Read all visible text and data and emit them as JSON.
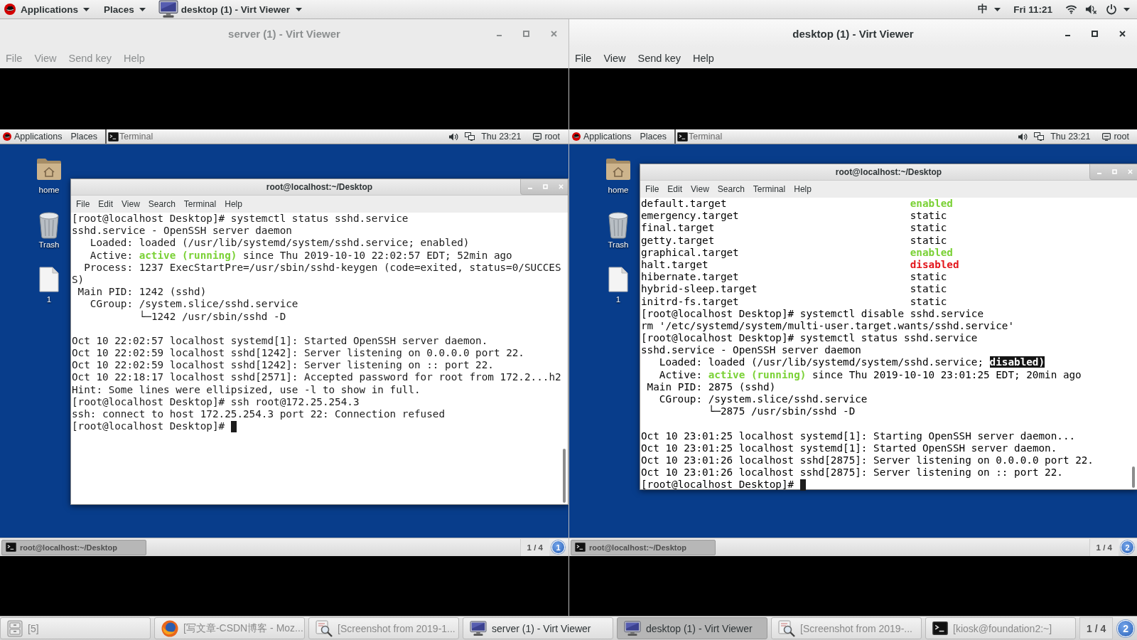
{
  "top_bar": {
    "menus": [
      "Applications",
      "Places"
    ],
    "app_menu": "desktop (1) - Virt Viewer",
    "input_method": "中",
    "clock": "Fri 11:21"
  },
  "windows": [
    {
      "title": "server (1) - Virt Viewer",
      "focused": false,
      "menu": [
        "File",
        "View",
        "Send key",
        "Help"
      ],
      "guest": {
        "panel": {
          "menus": [
            "Applications",
            "Places"
          ],
          "task": "Terminal",
          "clock": "Thu 23:21",
          "user": "root"
        },
        "desktop_icons": [
          {
            "kind": "home",
            "label": "home"
          },
          {
            "kind": "trash",
            "label": "Trash"
          },
          {
            "kind": "file",
            "label": "1"
          }
        ],
        "terminal": {
          "title": "root@localhost:~/Desktop",
          "menu": [
            "File",
            "Edit",
            "View",
            "Search",
            "Terminal",
            "Help"
          ],
          "lines": [
            {
              "kind": "text",
              "text": "[root@localhost Desktop]# systemctl status sshd.service"
            },
            {
              "kind": "text",
              "text": "sshd.service - OpenSSH server daemon"
            },
            {
              "kind": "field",
              "label": "Loaded:",
              "value": [
                {
                  "kind": "plain",
                  "text": "loaded (/usr/lib/systemd/system/sshd.service; enabled)"
                }
              ]
            },
            {
              "kind": "field",
              "label": "Active:",
              "value": [
                {
                  "kind": "ok",
                  "text": "active (running)"
                },
                {
                  "kind": "plain",
                  "text": " since Thu 2019-10-10 22:02:57 EDT; 52min ago"
                }
              ]
            },
            {
              "kind": "field",
              "label": "Process:",
              "value": [
                {
                  "kind": "plain",
                  "text": "1237 ExecStartPre=/usr/sbin/sshd-keygen (code=exited, status=0/SUCCES"
                }
              ]
            },
            {
              "kind": "text",
              "text": "S)"
            },
            {
              "kind": "field",
              "label": "Main PID:",
              "value": [
                {
                  "kind": "plain",
                  "text": "1242 (sshd)"
                }
              ]
            },
            {
              "kind": "field",
              "label": "CGroup:",
              "value": [
                {
                  "kind": "plain",
                  "text": "/system.slice/sshd.service"
                }
              ]
            },
            {
              "kind": "tree",
              "text": "└─1242 /usr/sbin/sshd -D"
            },
            {
              "kind": "blank"
            },
            {
              "kind": "text",
              "text": "Oct 10 22:02:57 localhost systemd[1]: Started OpenSSH server daemon."
            },
            {
              "kind": "text",
              "text": "Oct 10 22:02:59 localhost sshd[1242]: Server listening on 0.0.0.0 port 22."
            },
            {
              "kind": "text",
              "text": "Oct 10 22:02:59 localhost sshd[1242]: Server listening on :: port 22."
            },
            {
              "kind": "text",
              "text": "Oct 10 22:18:17 localhost sshd[2571]: Accepted password for root from 172.2...h2"
            },
            {
              "kind": "text",
              "text": "Hint: Some lines were ellipsized, use -l to show in full."
            },
            {
              "kind": "text",
              "text": "[root@localhost Desktop]# ssh root@172.25.254.3"
            },
            {
              "kind": "text",
              "text": "ssh: connect to host 172.25.254.3 port 22: Connection refused"
            },
            {
              "kind": "prompt",
              "text": "[root@localhost Desktop]#",
              "cursor": true
            }
          ]
        },
        "window_list": [
          {
            "label": "root@localhost:~/Desktop",
            "selected": true
          }
        ],
        "workspace": "1 / 4",
        "notifications": "1"
      }
    },
    {
      "title": "desktop (1) - Virt Viewer",
      "focused": true,
      "menu": [
        "File",
        "View",
        "Send key",
        "Help"
      ],
      "guest": {
        "panel": {
          "menus": [
            "Applications",
            "Places"
          ],
          "task": "Terminal",
          "clock": "Thu 23:21",
          "user": "root"
        },
        "desktop_icons": [
          {
            "kind": "home",
            "label": "home"
          },
          {
            "kind": "trash",
            "label": "Trash"
          },
          {
            "kind": "file",
            "label": "1"
          }
        ],
        "terminal": {
          "title": "root@localhost:~/Desktop",
          "menu": [
            "File",
            "Edit",
            "View",
            "Search",
            "Terminal",
            "Help"
          ],
          "lines": [
            {
              "kind": "unit",
              "unit": "default.target",
              "state": {
                "kind": "ok",
                "text": "enabled"
              }
            },
            {
              "kind": "unit",
              "unit": "emergency.target",
              "state": {
                "kind": "plain",
                "text": "static"
              }
            },
            {
              "kind": "unit",
              "unit": "final.target",
              "state": {
                "kind": "plain",
                "text": "static"
              }
            },
            {
              "kind": "unit",
              "unit": "getty.target",
              "state": {
                "kind": "plain",
                "text": "static"
              }
            },
            {
              "kind": "unit",
              "unit": "graphical.target",
              "state": {
                "kind": "ok",
                "text": "enabled"
              }
            },
            {
              "kind": "unit",
              "unit": "halt.target",
              "state": {
                "kind": "error",
                "text": "disabled"
              }
            },
            {
              "kind": "unit",
              "unit": "hibernate.target",
              "state": {
                "kind": "plain",
                "text": "static"
              }
            },
            {
              "kind": "unit",
              "unit": "hybrid-sleep.target",
              "state": {
                "kind": "plain",
                "text": "static"
              }
            },
            {
              "kind": "unit",
              "unit": "initrd-fs.target",
              "state": {
                "kind": "plain",
                "text": "static"
              }
            },
            {
              "kind": "text",
              "text": "[root@localhost Desktop]# systemctl disable sshd.service"
            },
            {
              "kind": "text",
              "text": "rm '/etc/systemd/system/multi-user.target.wants/sshd.service'"
            },
            {
              "kind": "text",
              "text": "[root@localhost Desktop]# systemctl status sshd.service"
            },
            {
              "kind": "text",
              "text": "sshd.service - OpenSSH server daemon"
            },
            {
              "kind": "field",
              "label": "Loaded:",
              "value": [
                {
                  "kind": "plain",
                  "text": "loaded (/usr/lib/systemd/system/sshd.service; "
                },
                {
                  "kind": "highlight",
                  "text": "disabled)"
                }
              ]
            },
            {
              "kind": "field",
              "label": "Active:",
              "value": [
                {
                  "kind": "ok",
                  "text": "active (running)"
                },
                {
                  "kind": "plain",
                  "text": " since Thu 2019-10-10 23:01:25 EDT; 20min ago"
                }
              ]
            },
            {
              "kind": "field",
              "label": "Main PID:",
              "value": [
                {
                  "kind": "plain",
                  "text": "2875 (sshd)"
                }
              ]
            },
            {
              "kind": "field",
              "label": "CGroup:",
              "value": [
                {
                  "kind": "plain",
                  "text": "/system.slice/sshd.service"
                }
              ]
            },
            {
              "kind": "tree",
              "text": "└─2875 /usr/sbin/sshd -D"
            },
            {
              "kind": "blank"
            },
            {
              "kind": "text",
              "text": "Oct 10 23:01:25 localhost systemd[1]: Starting OpenSSH server daemon..."
            },
            {
              "kind": "text",
              "text": "Oct 10 23:01:25 localhost systemd[1]: Started OpenSSH server daemon."
            },
            {
              "kind": "text",
              "text": "Oct 10 23:01:26 localhost sshd[2875]: Server listening on 0.0.0.0 port 22."
            },
            {
              "kind": "text",
              "text": "Oct 10 23:01:26 localhost sshd[2875]: Server listening on :: port 22."
            },
            {
              "kind": "prompt",
              "text": "[root@localhost Desktop]#",
              "cursor": true
            }
          ]
        },
        "window_list": [
          {
            "label": "root@localhost:~/Desktop",
            "selected": true
          }
        ],
        "workspace": "1 / 4",
        "notifications": "2"
      }
    }
  ],
  "taskbar": {
    "items": [
      {
        "kind": "files",
        "label": "[5]",
        "minimized": true,
        "selected": false
      },
      {
        "kind": "browser",
        "label": "[写文章-CSDN博客 - Moz...",
        "minimized": true,
        "selected": false
      },
      {
        "kind": "screenshot",
        "label": "[Screenshot from 2019-1...",
        "minimized": true,
        "selected": false
      },
      {
        "kind": "viewer",
        "label": "server (1) - Virt Viewer",
        "minimized": false,
        "selected": false
      },
      {
        "kind": "viewer",
        "label": "desktop (1) - Virt Viewer",
        "minimized": false,
        "selected": true
      },
      {
        "kind": "screenshot",
        "label": "[Screenshot from 2019-...",
        "minimized": true,
        "selected": false
      },
      {
        "kind": "terminal",
        "label": "[kiosk@foundation2:~]",
        "minimized": true,
        "selected": false
      }
    ],
    "workspace": "1 / 4",
    "notifications": "2"
  }
}
